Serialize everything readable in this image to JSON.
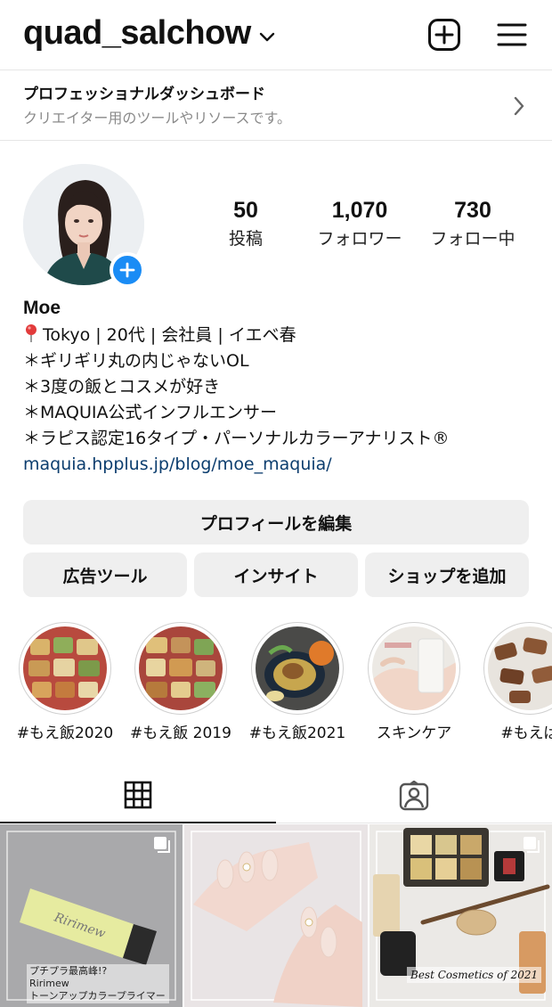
{
  "header": {
    "username": "quad_salchow"
  },
  "dashboard": {
    "title": "プロフェッショナルダッシュボード",
    "subtitle": "クリエイター用のツールやリソースです。"
  },
  "profile": {
    "stats": [
      {
        "value": "50",
        "label": "投稿"
      },
      {
        "value": "1,070",
        "label": "フォロワー"
      },
      {
        "value": "730",
        "label": "フォロー中"
      }
    ],
    "name": "Moe",
    "bio_lines": [
      "Tokyo | 20代 | 会社員 | イエベ春",
      "＊ギリギリ丸の内じゃないOL",
      "＊3度の飯とコスメが好き",
      "＊MAQUIA公式インフルエンサー",
      "＊ラピス認定16タイプ・パーソナルカラーアナリスト®"
    ],
    "link": "maquia.hpplus.jp/blog/moe_maquia/"
  },
  "buttons": {
    "edit_profile": "プロフィールを編集",
    "ad_tools": "広告ツール",
    "insights": "インサイト",
    "add_shop": "ショップを追加"
  },
  "highlights": [
    {
      "label": "#もえ飯2020"
    },
    {
      "label": "#もえ飯 2019"
    },
    {
      "label": "#もえ飯2021"
    },
    {
      "label": "スキンケア"
    },
    {
      "label": "#もえぱ"
    }
  ],
  "posts": [
    {
      "caption_lines": [
        "プチプラ最高峰!?",
        "Ririmew",
        "トーンアップカラープライマー"
      ],
      "product_text": "Ririmew"
    },
    {},
    {
      "caption": "Best Cosmetics of 2021"
    }
  ],
  "icons": {
    "chevron_down": "chevron-down-icon",
    "new_post": "plus-square-icon",
    "menu": "hamburger-icon",
    "chevron_right": "chevron-right-icon",
    "add_story": "plus-icon",
    "pin": "pin-icon",
    "grid": "grid-icon",
    "tagged": "tagged-person-icon",
    "multi": "carousel-icon"
  },
  "colors": {
    "accent": "#1a8cf5",
    "link": "#0b3d6e",
    "button_bg": "#efefef"
  }
}
